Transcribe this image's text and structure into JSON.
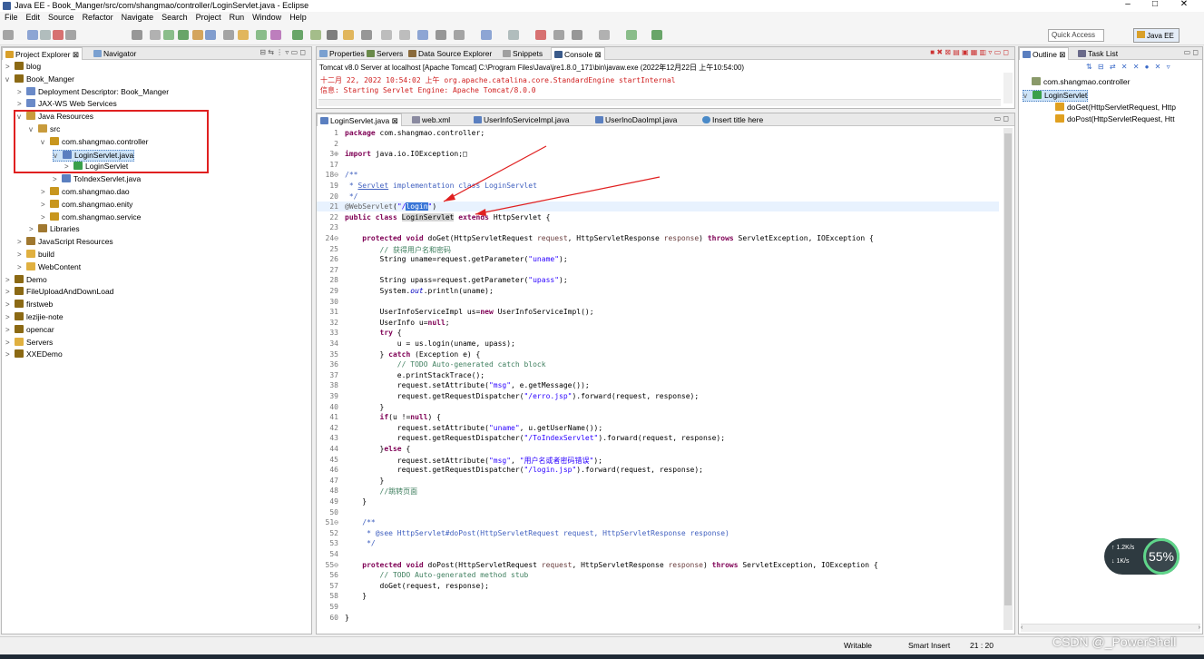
{
  "window": {
    "title": "Java EE - Book_Manger/src/com/shangmao/controller/LoginServlet.java - Eclipse",
    "min": "–",
    "max": "□",
    "close": "✕"
  },
  "menu": [
    "File",
    "Edit",
    "Source",
    "Refactor",
    "Navigate",
    "Search",
    "Project",
    "Run",
    "Window",
    "Help"
  ],
  "quick_access": "Quick Access",
  "perspective": "Java EE",
  "left_tabs": [
    "Project Explorer",
    "Navigator"
  ],
  "tree": [
    {
      "t": "blog",
      "lvl": 0,
      "tw": ">",
      "c": "#8b6914"
    },
    {
      "t": "Book_Manger",
      "lvl": 0,
      "tw": "v",
      "c": "#8b6914"
    },
    {
      "t": "Deployment Descriptor: Book_Manger",
      "lvl": 1,
      "tw": ">",
      "c": "#6a8ac8"
    },
    {
      "t": "JAX-WS Web Services",
      "lvl": 1,
      "tw": ">",
      "c": "#6a8ac8"
    },
    {
      "t": "Java Resources",
      "lvl": 1,
      "tw": "v",
      "c": "#c89b3c"
    },
    {
      "t": "src",
      "lvl": 2,
      "tw": "v",
      "c": "#c89b3c"
    },
    {
      "t": "com.shangmao.controller",
      "lvl": 3,
      "tw": "v",
      "c": "#c8961e"
    },
    {
      "t": "LoginServlet.java",
      "lvl": 4,
      "tw": "v",
      "c": "#5a7fc0",
      "sel": true
    },
    {
      "t": "LoginServlet",
      "lvl": 5,
      "tw": ">",
      "c": "#3aa04a"
    },
    {
      "t": "ToIndexServlet.java",
      "lvl": 4,
      "tw": ">",
      "c": "#5a7fc0"
    },
    {
      "t": "com.shangmao.dao",
      "lvl": 3,
      "tw": ">",
      "c": "#c8961e"
    },
    {
      "t": "com.shangmao.enity",
      "lvl": 3,
      "tw": ">",
      "c": "#c8961e"
    },
    {
      "t": "com.shangmao.service",
      "lvl": 3,
      "tw": ">",
      "c": "#c8961e"
    },
    {
      "t": "Libraries",
      "lvl": 2,
      "tw": ">",
      "c": "#a07830"
    },
    {
      "t": "JavaScript Resources",
      "lvl": 1,
      "tw": ">",
      "c": "#a07830"
    },
    {
      "t": "build",
      "lvl": 1,
      "tw": ">",
      "c": "#e0b040"
    },
    {
      "t": "WebContent",
      "lvl": 1,
      "tw": ">",
      "c": "#e0b040"
    },
    {
      "t": "Demo",
      "lvl": 0,
      "tw": ">",
      "c": "#8b6914"
    },
    {
      "t": "FileUploadAndDownLoad",
      "lvl": 0,
      "tw": ">",
      "c": "#8b6914"
    },
    {
      "t": "firstweb",
      "lvl": 0,
      "tw": ">",
      "c": "#8b6914"
    },
    {
      "t": "lezijie-note",
      "lvl": 0,
      "tw": ">",
      "c": "#8b6914"
    },
    {
      "t": "opencar",
      "lvl": 0,
      "tw": ">",
      "c": "#8b6914"
    },
    {
      "t": "Servers",
      "lvl": 0,
      "tw": ">",
      "c": "#e0b040"
    },
    {
      "t": "XXEDemo",
      "lvl": 0,
      "tw": ">",
      "c": "#8b6914"
    }
  ],
  "console_tabs": [
    "Properties",
    "Servers",
    "Data Source Explorer",
    "Snippets",
    "Console"
  ],
  "console_header": "Tomcat v8.0 Server at localhost [Apache Tomcat] C:\\Program Files\\Java\\jre1.8.0_171\\bin\\javaw.exe (2022年12月22日 上午10:54:00)",
  "console_lines": [
    "十二月 22, 2022 10:54:02 上午 org.apache.catalina.core.StandardEngine startInternal",
    "信息: Starting Servlet Engine: Apache Tomcat/8.0.0"
  ],
  "editor_tabs": [
    "LoginServlet.java",
    "web.xml",
    "UserInfoServiceImpl.java",
    "UserInoDaoImpl.java",
    "Insert title here"
  ],
  "code": [
    {
      "n": "1",
      "h": "<span class=\"kw\">package</span> com.shangmao.controller;"
    },
    {
      "n": "2",
      "h": ""
    },
    {
      "n": "3⊕",
      "h": "<span class=\"kw\">import</span> java.io.IOException;□"
    },
    {
      "n": "17",
      "h": ""
    },
    {
      "n": "18⊖",
      "h": "<span class=\"jd\">/**</span>"
    },
    {
      "n": "19",
      "h": "<span class=\"jd\"> * <u>Servlet</u> implementation class LoginServlet</span>"
    },
    {
      "n": "20",
      "h": "<span class=\"jd\"> */</span>"
    },
    {
      "n": "21",
      "h": "<span class=\"an\">@WebServlet</span>(<span class=\"st\">\"/<span style=\"background:#3875d7;color:#fff\">login</span>\"</span>)",
      "cur": true
    },
    {
      "n": "22",
      "h": "<span class=\"kw\">public</span> <span class=\"kw\">class</span> <span style=\"background:#d4d4d4\">LoginServlet</span> <span class=\"kw\">extends</span> HttpServlet {"
    },
    {
      "n": "23",
      "h": ""
    },
    {
      "n": "24⊖",
      "h": "    <span class=\"kw\">protected</span> <span class=\"kw\">void</span> doGet(HttpServletRequest <span style=\"color:#6a3e3e\">request</span>, HttpServletResponse <span style=\"color:#6a3e3e\">response</span>) <span class=\"kw\">throws</span> ServletException, IOException {"
    },
    {
      "n": "25",
      "h": "        <span class=\"cm\">// 获得用户名和密码</span>"
    },
    {
      "n": "26",
      "h": "        String uname=request.getParameter(<span class=\"st\">\"uname\"</span>);"
    },
    {
      "n": "27",
      "h": ""
    },
    {
      "n": "28",
      "h": "        String upass=request.getParameter(<span class=\"st\">\"upass\"</span>);"
    },
    {
      "n": "29",
      "h": "        System.<span class=\"fd\">out</span>.println(uname);"
    },
    {
      "n": "30",
      "h": ""
    },
    {
      "n": "31",
      "h": "        UserInfoServiceImpl us=<span class=\"kw\">new</span> UserInfoServiceImpl();"
    },
    {
      "n": "32",
      "h": "        UserInfo u=<span class=\"kw\">null</span>;"
    },
    {
      "n": "33",
      "h": "        <span class=\"kw\">try</span> {"
    },
    {
      "n": "34",
      "h": "            u = us.login(uname, upass);"
    },
    {
      "n": "35",
      "h": "        } <span class=\"kw\">catch</span> (Exception e) {"
    },
    {
      "n": "36",
      "h": "            <span class=\"cm\">// TODO Auto-generated catch block</span>"
    },
    {
      "n": "37",
      "h": "            e.printStackTrace();"
    },
    {
      "n": "38",
      "h": "            request.setAttribute(<span class=\"st\">\"msg\"</span>, e.getMessage());"
    },
    {
      "n": "39",
      "h": "            request.getRequestDispatcher(<span class=\"st\">\"/erro.jsp\"</span>).forward(request, response);"
    },
    {
      "n": "40",
      "h": "        }"
    },
    {
      "n": "41",
      "h": "        <span class=\"kw\">if</span>(u !=<span class=\"kw\">null</span>) {"
    },
    {
      "n": "42",
      "h": "            request.setAttribute(<span class=\"st\">\"uname\"</span>, u.getUserName());"
    },
    {
      "n": "43",
      "h": "            request.getRequestDispatcher(<span class=\"st\">\"/ToIndexServlet\"</span>).forward(request, response);"
    },
    {
      "n": "44",
      "h": "        }<span class=\"kw\">else</span> {"
    },
    {
      "n": "45",
      "h": "            request.setAttribute(<span class=\"st\">\"msg\"</span>, <span class=\"st\">\"用户名或者密码错误\"</span>);"
    },
    {
      "n": "46",
      "h": "            request.getRequestDispatcher(<span class=\"st\">\"/login.jsp\"</span>).forward(request, response);"
    },
    {
      "n": "47",
      "h": "        }"
    },
    {
      "n": "48",
      "h": "        <span class=\"cm\">//跳转页面</span>"
    },
    {
      "n": "49",
      "h": "    }"
    },
    {
      "n": "50",
      "h": ""
    },
    {
      "n": "51⊖",
      "h": "    <span class=\"jd\">/**</span>"
    },
    {
      "n": "52",
      "h": "<span class=\"jd\">     * @see HttpServlet#doPost(HttpServletRequest request, HttpServletResponse response)</span>"
    },
    {
      "n": "53",
      "h": "<span class=\"jd\">     */</span>"
    },
    {
      "n": "54",
      "h": ""
    },
    {
      "n": "55⊖",
      "h": "    <span class=\"kw\">protected</span> <span class=\"kw\">void</span> doPost(HttpServletRequest <span style=\"color:#6a3e3e\">request</span>, HttpServletResponse <span style=\"color:#6a3e3e\">response</span>) <span class=\"kw\">throws</span> ServletException, IOException {"
    },
    {
      "n": "56",
      "h": "        <span class=\"cm\">// TODO Auto-generated method stub</span>"
    },
    {
      "n": "57",
      "h": "        doGet(request, response);"
    },
    {
      "n": "58",
      "h": "    }"
    },
    {
      "n": "59",
      "h": ""
    },
    {
      "n": "60",
      "h": "}"
    }
  ],
  "outline_tabs": [
    "Outline",
    "Task List"
  ],
  "outline": [
    {
      "t": "com.shangmao.controller",
      "lvl": 0,
      "tw": "",
      "c": "#8a9a6a"
    },
    {
      "t": "LoginServlet",
      "lvl": 0,
      "tw": "v",
      "c": "#3aa04a",
      "sel": true
    },
    {
      "t": "doGet(HttpServletRequest, Http",
      "lvl": 1,
      "tw": "",
      "c": "#e0a020"
    },
    {
      "t": "doPost(HttpServletRequest, Htt",
      "lvl": 1,
      "tw": "",
      "c": "#e0a020"
    }
  ],
  "status": {
    "writable": "Writable",
    "insert": "Smart Insert",
    "pos": "21 : 20"
  },
  "net": {
    "up": "↑ 1.2K/s",
    "down": "↓ 1K/s",
    "cpu": "55%"
  },
  "watermark": "CSDN @_PowerShell"
}
